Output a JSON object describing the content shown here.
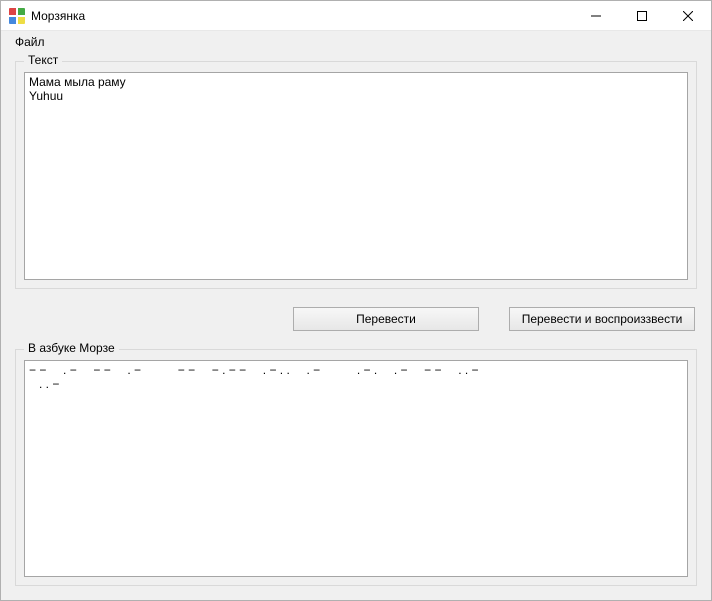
{
  "window": {
    "title": "Морзянка"
  },
  "menu": {
    "file": "Файл"
  },
  "groups": {
    "text_legend": "Текст",
    "morse_legend": "В азбуке Морзе"
  },
  "text_input": {
    "value": "Мама мыла раму\nYuhuu"
  },
  "buttons": {
    "translate": "Перевести",
    "translate_play": "Перевести и воспроиззвести"
  },
  "morse_output": {
    "value": "− −     . −     − −     . −           − −     − . − −     . − . .     . −           . − .     . −     − −     . . −     \n   . . −   "
  }
}
